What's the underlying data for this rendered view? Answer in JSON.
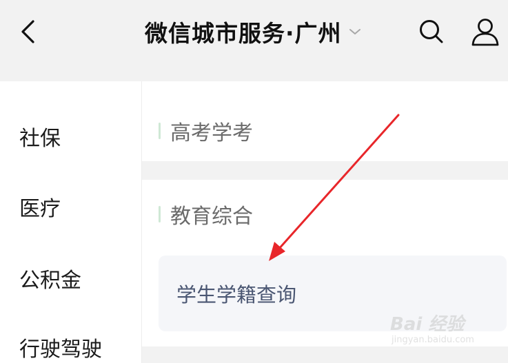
{
  "header": {
    "title": "微信城市服务·广州",
    "back_icon": "chevron-left-icon",
    "dropdown_icon": "chevron-down-icon",
    "search_icon": "search-icon",
    "user_icon": "user-icon"
  },
  "sidebar": {
    "items": [
      {
        "label": "社保"
      },
      {
        "label": "医疗"
      },
      {
        "label": "公积金"
      },
      {
        "label": "行驶驾驶"
      }
    ]
  },
  "main": {
    "sections": [
      {
        "title": "高考学考",
        "items": []
      },
      {
        "title": "教育综合",
        "items": [
          {
            "label": "学生学籍查询"
          }
        ]
      }
    ]
  },
  "watermark": {
    "text": "Bai 经验",
    "sub": "jingyan.baidu.com"
  },
  "colors": {
    "accent_bar": "#cfe8d5",
    "annotation_arrow": "#e8262a",
    "tile_text": "#4a5672"
  }
}
